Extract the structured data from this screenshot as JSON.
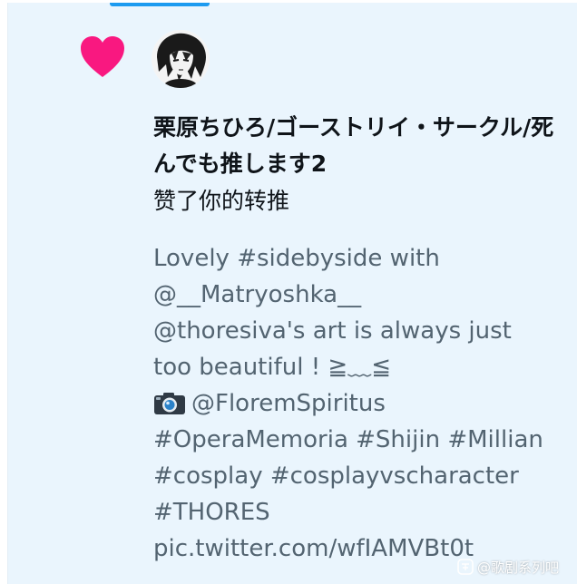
{
  "notification": {
    "user_name": "栗原ちひろ/ゴーストリイ・サークル/死んでも推します2",
    "action_text": "赞了你的转推",
    "tweet_lines": [
      "Lovely #sidebyside with",
      "@__Matryoshka__",
      "  @thoresiva's art is always just",
      "too beautiful ! ≧﹏≦",
      "@FloremSpiritus",
      "#OperaMemoria #Shijin #Millian",
      "#cosplay #cosplayvscharacter",
      "#THORES",
      "pic.twitter.com/wfIAMVBt0t"
    ]
  },
  "icons": {
    "like": "heart-icon",
    "camera": "camera-icon"
  },
  "watermark": {
    "text": "@歌剧系列吧"
  },
  "colors": {
    "background": "#eaf5fd",
    "heart": "#f91880",
    "accent": "#1d9bf0",
    "primary_text": "#0f1419",
    "secondary_text": "#536471"
  }
}
